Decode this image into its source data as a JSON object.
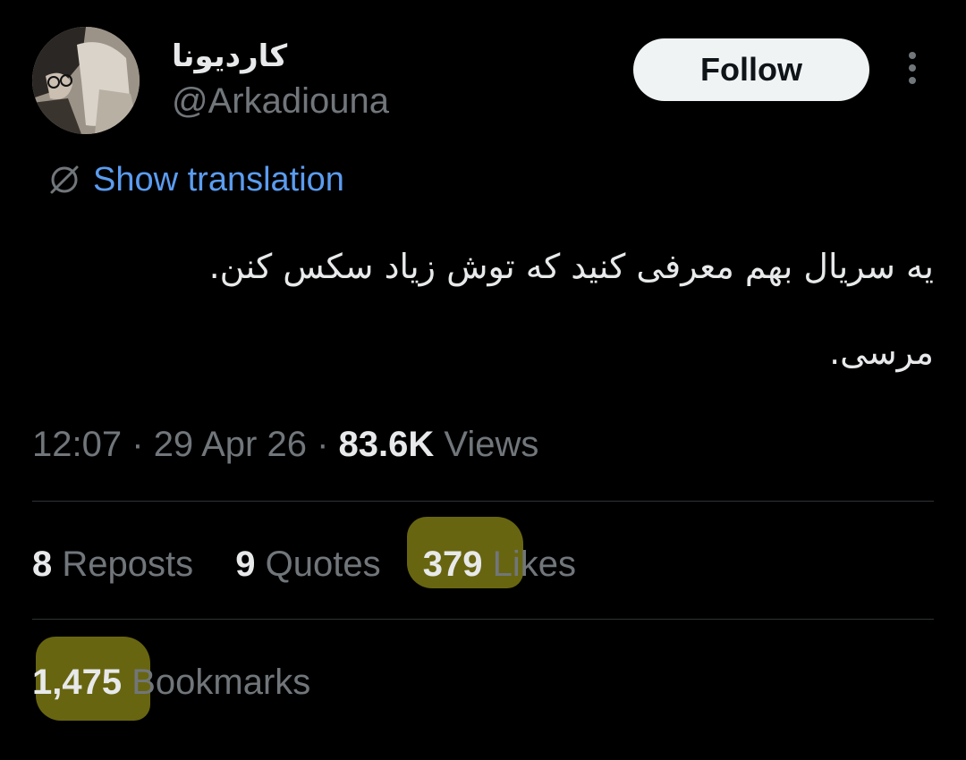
{
  "author": {
    "display_name": "کاردیونا",
    "handle": "@Arkadiouna"
  },
  "header": {
    "follow_label": "Follow",
    "more_icon": "more-vertical-icon"
  },
  "translation": {
    "label": "Show translation",
    "icon": "translate-icon"
  },
  "tweet": {
    "line1": "یه سریال بهم معرفی کنید که توش زیاد سکس کنن.",
    "line2": "مرسی."
  },
  "meta": {
    "time": "12:07",
    "separator": "·",
    "date": "29 Apr 26",
    "views_count": "83.6K",
    "views_label": "Views"
  },
  "stats": {
    "reposts_count": "8",
    "reposts_label": "Reposts",
    "quotes_count": "9",
    "quotes_label": "Quotes",
    "likes_count": "379",
    "likes_label": "Likes",
    "bookmarks_count": "1,475",
    "bookmarks_label": "Bookmarks"
  },
  "colors": {
    "background": "#000000",
    "text_primary": "#e7e9ea",
    "text_secondary": "#71767b",
    "link": "#5b9cf0",
    "follow_bg": "#eff3f4",
    "highlight": "#6e6a12",
    "divider": "#2f3336"
  }
}
